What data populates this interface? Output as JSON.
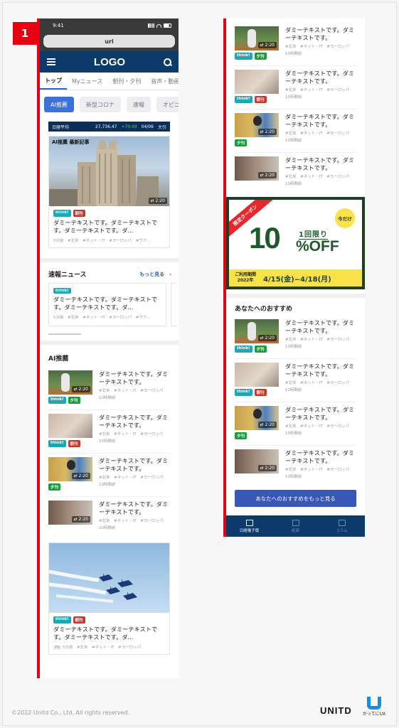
{
  "step": "1",
  "status": {
    "time": "9:41"
  },
  "urlbar": {
    "text": "url"
  },
  "appbar": {
    "logo": "LOGO"
  },
  "tabs": [
    "トップ",
    "Myニュース",
    "朝刊・夕刊",
    "音声・動画"
  ],
  "chips": [
    "AI推薦",
    "新型コロナ",
    "速報",
    "オピニ"
  ],
  "ticker": {
    "label": "日経平均",
    "value": "27,736.47",
    "change": "+70.49",
    "date": "04/06",
    "suffix": "大引"
  },
  "feature": {
    "label": "AI推薦 最新記事",
    "duration": "2:20",
    "tags": [
      "think!",
      "朝刊"
    ],
    "title": "ダミーテキストです。ダミーテキストです。ダミーテキストです。ダ...",
    "meta": "5分前　#北米　#ネット・IT　#ヨーロッパ　#ウク..."
  },
  "breaking": {
    "title": "速報ニュース",
    "more": "もっと見る　›",
    "card": {
      "tag": "think!",
      "title": "ダミーテキストです。ダミーテキストです。ダミーテキストです。ダ...",
      "meta": "5分前　#北米　#ネット・IT　#ヨーロッパ　#ウク..."
    }
  },
  "ai_section": {
    "title": "AI推薦",
    "items": [
      {
        "tags": [
          "think!",
          "夕刊"
        ],
        "duration": "2:20",
        "title": "ダミーテキストです。ダミーテキストです。",
        "meta": "#北米　#ネット・IT　#ヨーロッパ",
        "time": "10時間前"
      },
      {
        "tags": [
          "think!",
          "朝刊"
        ],
        "duration": "",
        "title": "ダミーテキストです。ダミーテキストです。",
        "meta": "#北米　#ネット・IT　#ヨーロッパ",
        "time": "10時間前"
      },
      {
        "tags": [
          "夕刊"
        ],
        "duration": "2:20",
        "title": "ダミーテキストです。ダミーテキストです。",
        "meta": "#北米　#ネット・IT　#ヨーロッパ",
        "time": "10時間前"
      },
      {
        "tags": [],
        "duration": "2:20",
        "title": "ダミーテキストです。ダミーテキストです。",
        "meta": "#北米　#ネット・IT　#ヨーロッパ",
        "time": "10時間前"
      }
    ]
  },
  "pr_card": {
    "tags": [
      "think!",
      "朝刊"
    ],
    "title": "ダミーテキストです。ダミーテキストです。ダミーテキストです。ダ...",
    "pr": "PR",
    "meta": "5分前　#北米　#ネット・IT　#ヨーロッパ"
  },
  "right_items": [
    {
      "tags": [
        "think!",
        "夕刊"
      ],
      "duration": "2:20",
      "title": "ダミーテキストです。ダミーテキストです。",
      "meta": "#北米　#ネット・IT　#ヨーロッパ",
      "time": "10時間前"
    },
    {
      "tags": [
        "think!",
        "朝刊"
      ],
      "duration": "",
      "title": "ダミーテキストです。ダミーテキストです。",
      "meta": "#北米　#ネット・IT　#ヨーロッパ",
      "time": "10時間前"
    },
    {
      "tags": [
        "夕刊"
      ],
      "duration": "2:20",
      "title": "ダミーテキストです。ダミーテキストです。",
      "meta": "#北米　#ネット・IT　#ヨーロッパ",
      "time": "10時間前"
    },
    {
      "tags": [],
      "duration": "2:20",
      "title": "ダミーテキストです。ダミーテキストです。",
      "meta": "#北米　#ネット・IT　#ヨーロッパ",
      "time": "10時間前"
    }
  ],
  "coupon": {
    "ribbon": "限定クーポン",
    "badge": "今だけ",
    "percent": "10",
    "once": "1回限り",
    "off": "%OFF",
    "period_label": "ご利用期間",
    "year": "2022年",
    "dates": "4/15(金)~4/18(月)"
  },
  "recommend": {
    "title": "あなたへのおすすめ",
    "items": [
      {
        "tags": [
          "think!",
          "夕刊"
        ],
        "duration": "2:20",
        "title": "ダミーテキストです。ダミーテキストです。",
        "meta": "#北米　#ネット・IT　#ヨーロッパ",
        "time": "10時間前"
      },
      {
        "tags": [
          "think!",
          "朝刊"
        ],
        "duration": "",
        "title": "ダミーテキストです。ダミーテキストです。",
        "meta": "#北米　#ネット・IT　#ヨーロッパ",
        "time": "10時間前"
      },
      {
        "tags": [
          "夕刊"
        ],
        "duration": "2:20",
        "title": "ダミーテキストです。ダミーテキストです。",
        "meta": "#北米　#ネット・IT　#ヨーロッパ",
        "time": "10時間前"
      },
      {
        "tags": [],
        "duration": "2:20",
        "title": "ダミーテキストです。ダミーテキストです。",
        "meta": "#北米　#ネット・IT　#ヨーロッパ",
        "time": "10時間前"
      }
    ],
    "cta": "あなたへのおすすめをもっと見る"
  },
  "bottomnav": [
    "日経電子版",
    "紙面",
    "コラム"
  ],
  "footer": {
    "copyright": "©2022 Unitd Co., Ltd. All rights reserved.",
    "brand": "UNITD",
    "brand2": "かってにUX"
  },
  "colors": {
    "accent": "#e60012",
    "navy": "#0b3a6b",
    "link": "#2c63c8",
    "coupon_green": "#1e5a2b",
    "coupon_yellow": "#f7e347"
  }
}
